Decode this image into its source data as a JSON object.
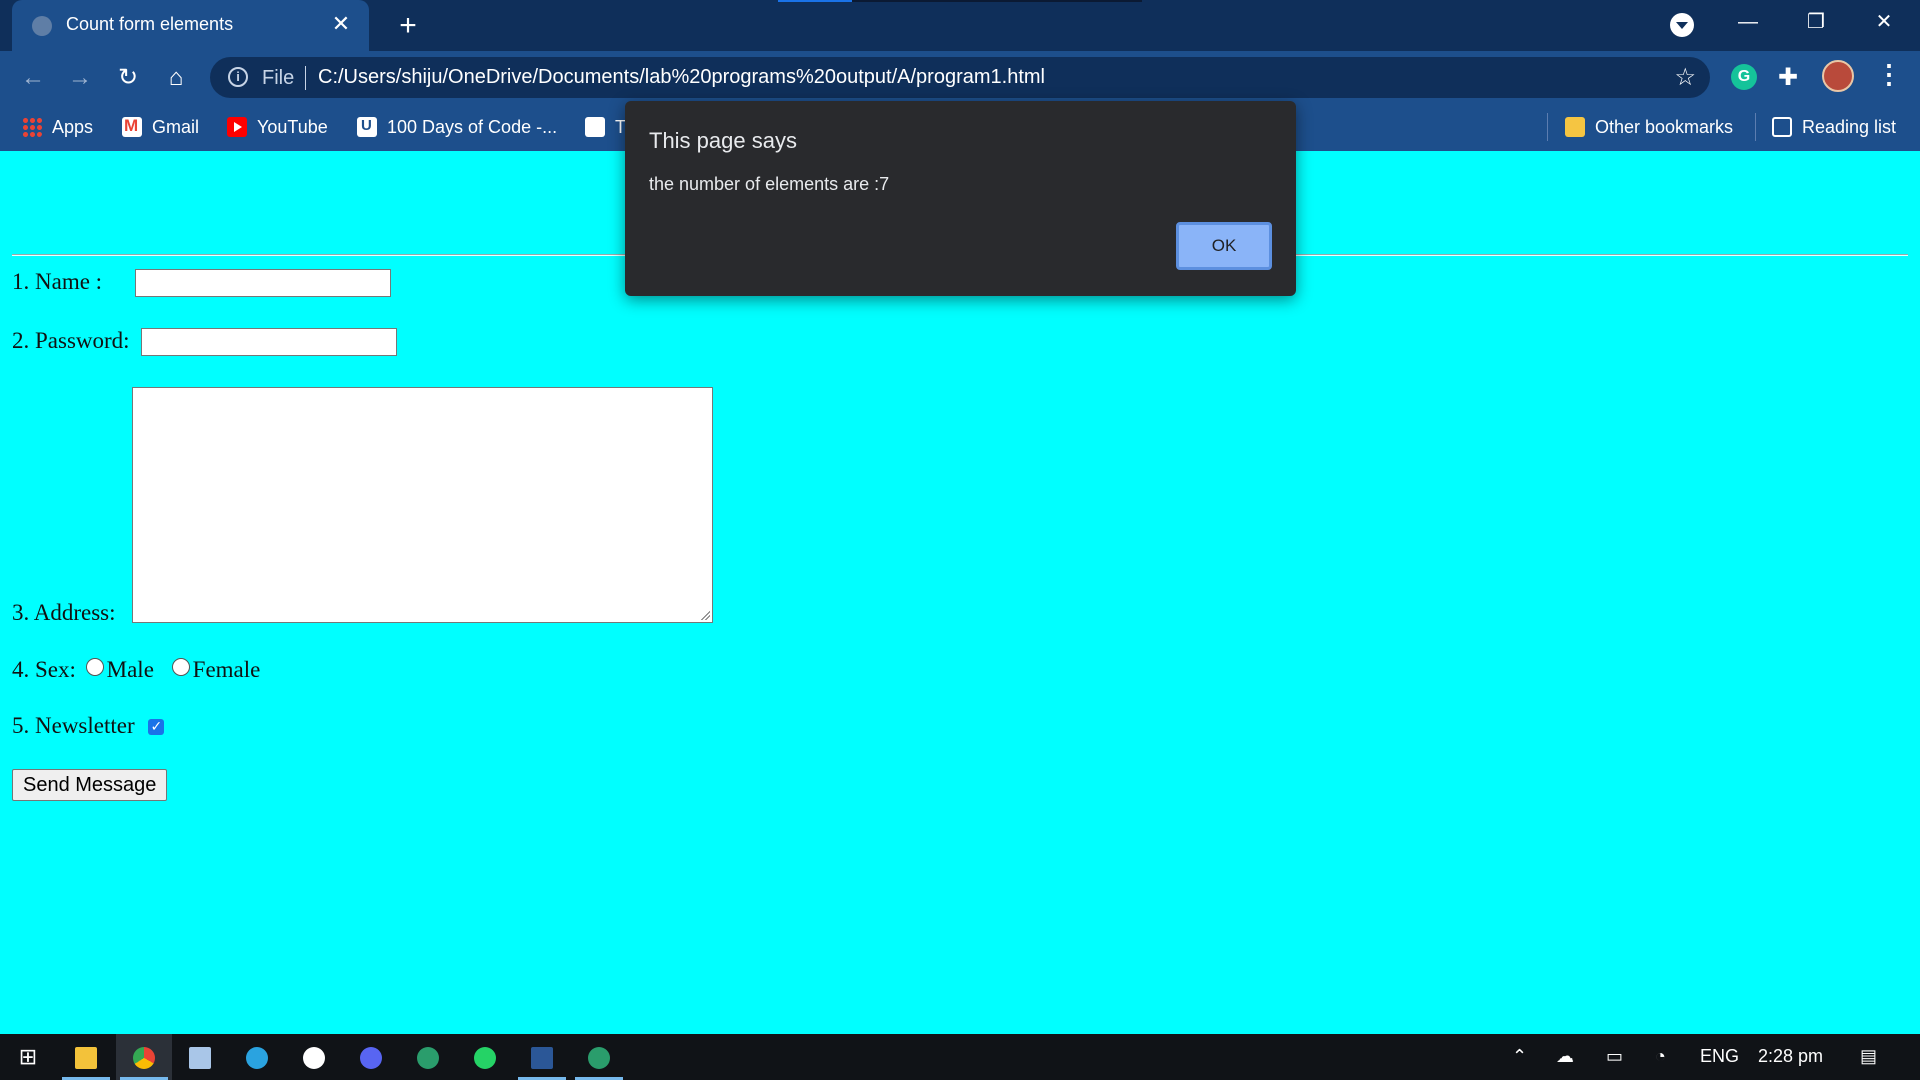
{
  "browser": {
    "tab_title": "Count form elements",
    "tab_close": "✕",
    "new_tab": "+",
    "url_scheme": "File",
    "url": "C:/Users/shiju/OneDrive/Documents/lab%20programs%20output/A/program1.html",
    "bookmarks": {
      "apps": "Apps",
      "gmail": "Gmail",
      "youtube": "YouTube",
      "days_of_code": "100 Days of Code -...",
      "partial": "T",
      "other": "Other bookmarks",
      "reading_list": "Reading list"
    }
  },
  "form": {
    "name_label": "1. Name :",
    "password_label": "2. Password:",
    "address_label": "3. Address:",
    "sex_label": "4. Sex:",
    "male_label": "Male",
    "female_label": "Female",
    "newsletter_label": "5. Newsletter",
    "newsletter_checked": true,
    "send_button": "Send Message"
  },
  "dialog": {
    "title": "This page says",
    "message": "the number of elements are :7",
    "ok_label": "OK"
  },
  "taskbar": {
    "language": "ENG",
    "time": "2:28 pm"
  },
  "colors": {
    "page_background": "#00ffff",
    "browser_chrome": "#1d4f8c",
    "dialog_background": "#292a2d",
    "dialog_button": "#8ab4f8"
  }
}
